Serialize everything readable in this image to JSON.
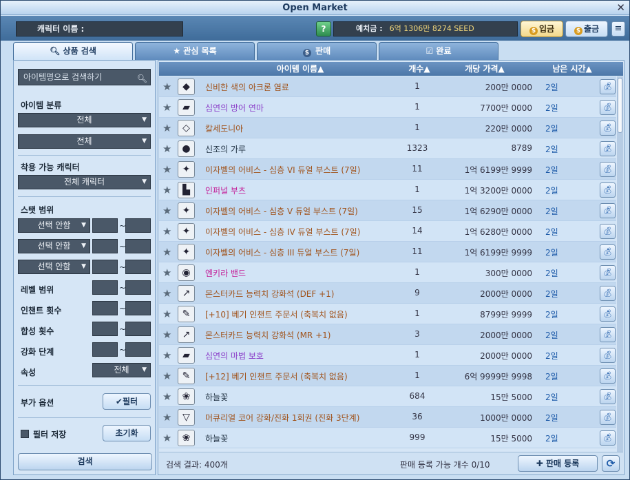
{
  "window": {
    "title": "Open Market"
  },
  "topbar": {
    "char_label": "캐릭터 이름 :",
    "help": "?",
    "deposit_label": "예치금 :",
    "deposit_value": "6억 1306만 8274 SEED",
    "deposit_btn": "입금",
    "withdraw_btn": "출금",
    "coin_glyph": "$"
  },
  "tabs": [
    {
      "label": "상품 검색"
    },
    {
      "label": "관심 목록"
    },
    {
      "label": "판매"
    },
    {
      "label": "완료"
    }
  ],
  "filters": {
    "search_placeholder": "아이템명으로 검색하기",
    "category_label": "아이템 분류",
    "category1": "전체",
    "category2": "전체",
    "char_label": "착용 가능 캐릭터",
    "char_value": "전체 캐릭터",
    "stat_label": "스탯 범위",
    "stat_select": "선택 안함",
    "level_label": "레벨 범위",
    "enchant_label": "인챈트 횟수",
    "synth_label": "합성 횟수",
    "reinforce_label": "강화 단계",
    "attr_label": "속성",
    "attr_value": "전체",
    "extra_label": "부가 옵션",
    "filter_btn": "필터",
    "save_label": "필터 저장",
    "reset_btn": "초기화",
    "search_btn": "검색",
    "tilde": "~"
  },
  "table": {
    "headers": {
      "name": "아이템 이름▲",
      "qty": "개수▲",
      "price": "개당 가격▲",
      "time": "남은 시간▲"
    },
    "rows": [
      {
        "name": "신비한 색의 아크론 염료",
        "qty": "1",
        "price": "200만 0000",
        "time": "2일",
        "color": "#a0521a",
        "icon": "◆"
      },
      {
        "name": "심연의 방어 연마",
        "qty": "1",
        "price": "7700만 0000",
        "time": "2일",
        "color": "#8a3cc8",
        "icon": "▰"
      },
      {
        "name": "칼세도니아",
        "qty": "1",
        "price": "220만 0000",
        "time": "2일",
        "color": "#a0521a",
        "icon": "◇"
      },
      {
        "name": "신조의 가루",
        "qty": "1323",
        "price": "8789",
        "time": "2일",
        "color": "#223344",
        "icon": "●"
      },
      {
        "name": "이자벨의 어비스 - 심층 VI 듀얼 부스트 (7일)",
        "qty": "11",
        "price": "1억 6199만 9999",
        "time": "2일",
        "color": "#a0521a",
        "icon": "✦"
      },
      {
        "name": "인퍼널 부츠",
        "qty": "1",
        "price": "1억 3200만 0000",
        "time": "2일",
        "color": "#c4229a",
        "icon": "▙"
      },
      {
        "name": "이자벨의 어비스 - 심층 V 듀얼 부스트 (7일)",
        "qty": "15",
        "price": "1억 6290만 0000",
        "time": "2일",
        "color": "#a0521a",
        "icon": "✦"
      },
      {
        "name": "이자벨의 어비스 - 심층 IV 듀얼 부스트 (7일)",
        "qty": "14",
        "price": "1억 6280만 0000",
        "time": "2일",
        "color": "#a0521a",
        "icon": "✦"
      },
      {
        "name": "이자벨의 어비스 - 심층 III 듀얼 부스트 (7일)",
        "qty": "11",
        "price": "1억 6199만 9999",
        "time": "2일",
        "color": "#a0521a",
        "icon": "✦"
      },
      {
        "name": "엔키라 밴드",
        "qty": "1",
        "price": "300만 0000",
        "time": "2일",
        "color": "#c4229a",
        "icon": "◉"
      },
      {
        "name": "몬스터카드 능력치 강화석 (DEF +1)",
        "qty": "9",
        "price": "2000만 0000",
        "time": "2일",
        "color": "#a0521a",
        "icon": "↗"
      },
      {
        "name": "[+10] 베기 인챈트 주문서 (축복치 없음)",
        "qty": "1",
        "price": "8799만 9999",
        "time": "2일",
        "color": "#a0521a",
        "icon": "✎"
      },
      {
        "name": "몬스터카드 능력치 강화석 (MR +1)",
        "qty": "3",
        "price": "2000만 0000",
        "time": "2일",
        "color": "#a0521a",
        "icon": "↗"
      },
      {
        "name": "심연의 마법 보호",
        "qty": "1",
        "price": "2000만 0000",
        "time": "2일",
        "color": "#8a3cc8",
        "icon": "▰"
      },
      {
        "name": "[+12] 베기 인챈트 주문서 (축복치 없음)",
        "qty": "1",
        "price": "6억 9999만 9998",
        "time": "2일",
        "color": "#a0521a",
        "icon": "✎"
      },
      {
        "name": "하늘꽃",
        "qty": "684",
        "price": "15만 5000",
        "time": "2일",
        "color": "#223344",
        "icon": "❀"
      },
      {
        "name": "머큐리얼 코어 강화/진화 1회권 (진화 3단계)",
        "qty": "36",
        "price": "1000만 0000",
        "time": "2일",
        "color": "#a0521a",
        "icon": "▽"
      },
      {
        "name": "하늘꽃",
        "qty": "999",
        "price": "15만 5000",
        "time": "2일",
        "color": "#223344",
        "icon": "❀"
      }
    ]
  },
  "footer": {
    "result": "검색 결과: 400개",
    "capacity": "판매 등록 가능 개수 0/10",
    "register_btn": "판매 등록",
    "refresh_glyph": "⟳"
  }
}
